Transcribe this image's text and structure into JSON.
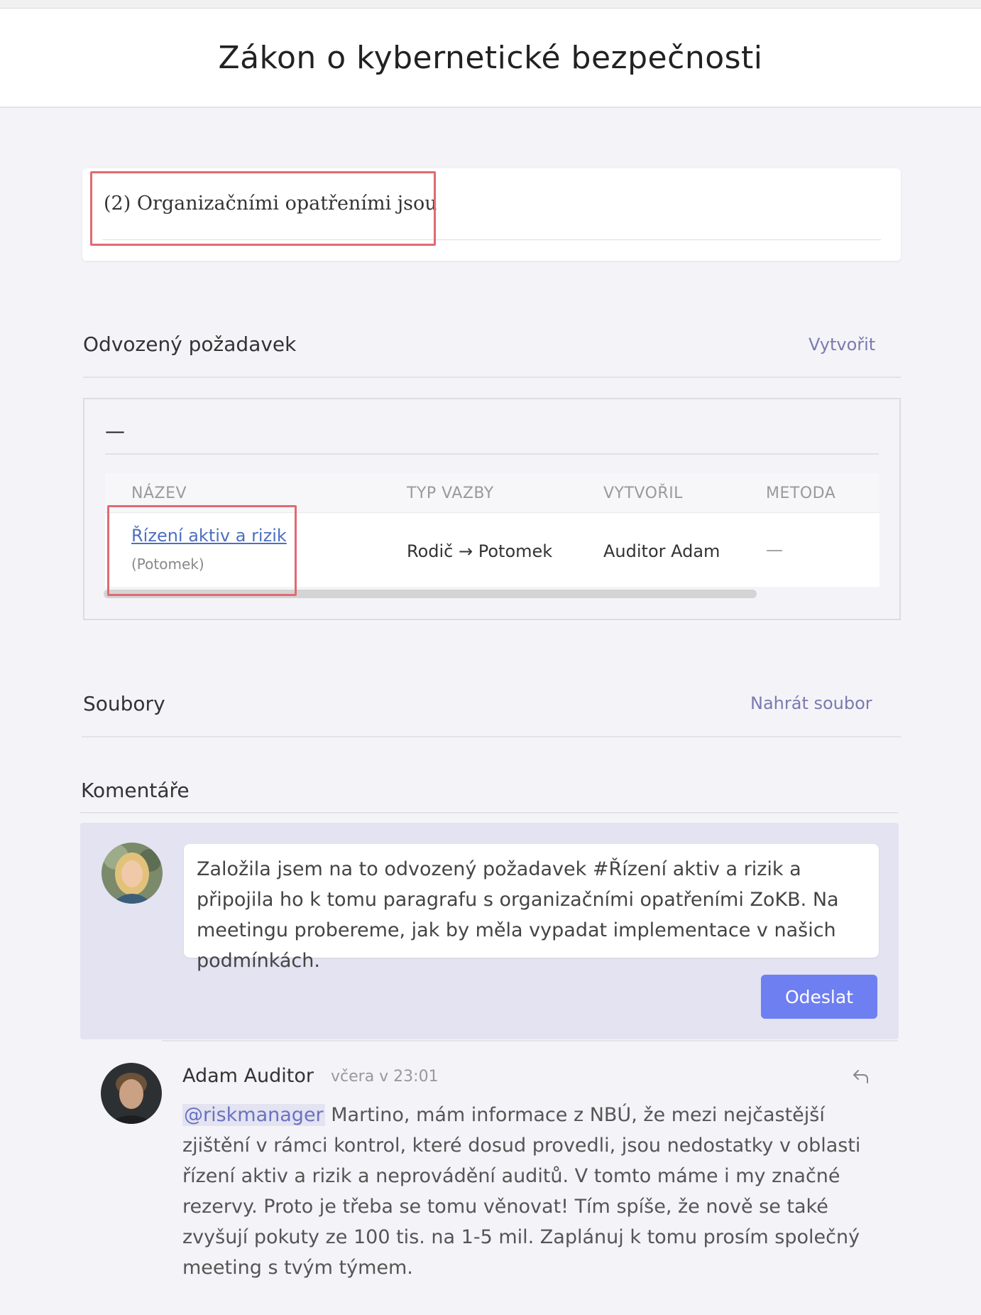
{
  "page": {
    "title": "Zákon o kybernetické bezpečnosti"
  },
  "paragraph": {
    "text": "(2) Organizačními opatřeními jsou"
  },
  "derived": {
    "title": "Odvozený požadavek",
    "action": "Vytvořit",
    "group_label": "—",
    "columns": [
      "NÁZEV",
      "TYP VAZBY",
      "VYTVOŘIL",
      "METODA"
    ],
    "rows": [
      {
        "name": "Řízení aktiv a rizik",
        "sub": "(Potomek)",
        "type": "Rodič → Potomek",
        "author": "Auditor Adam",
        "method": "—"
      }
    ]
  },
  "files": {
    "title": "Soubory",
    "action": "Nahrát soubor"
  },
  "comments": {
    "title": "Komentáře",
    "draft": "Založila jsem na to odvozený požadavek #Řízení aktiv a rizik a připojila ho k tomu paragrafu s organizačními opatřeními ZoKB. Na meetingu probereme, jak by měla vypadat implementace v našich podmínkách.",
    "send_label": "Odeslat",
    "items": [
      {
        "author": "Adam Auditor",
        "time": "včera v 23:01",
        "mention": "@riskmanager",
        "text": " Martino, mám informace z NBÚ, že mezi nejčastější zjištění v rámci kontrol, které dosud provedli, jsou nedostatky v oblasti řízení aktiv a rizik a neprovádění auditů. V tomto máme i my značné rezervy. Proto je třeba se tomu věnovat! Tím spíše, že nově se také zvyšují pokuty ze 100 tis. na 1-5 mil. Zaplánuj k tomu prosím společný meeting s tvým týmem."
      }
    ]
  },
  "colors": {
    "accent": "#6e7ff2",
    "highlight": "#e06a73",
    "link": "#4d6fbf",
    "action": "#7a7ab0"
  }
}
